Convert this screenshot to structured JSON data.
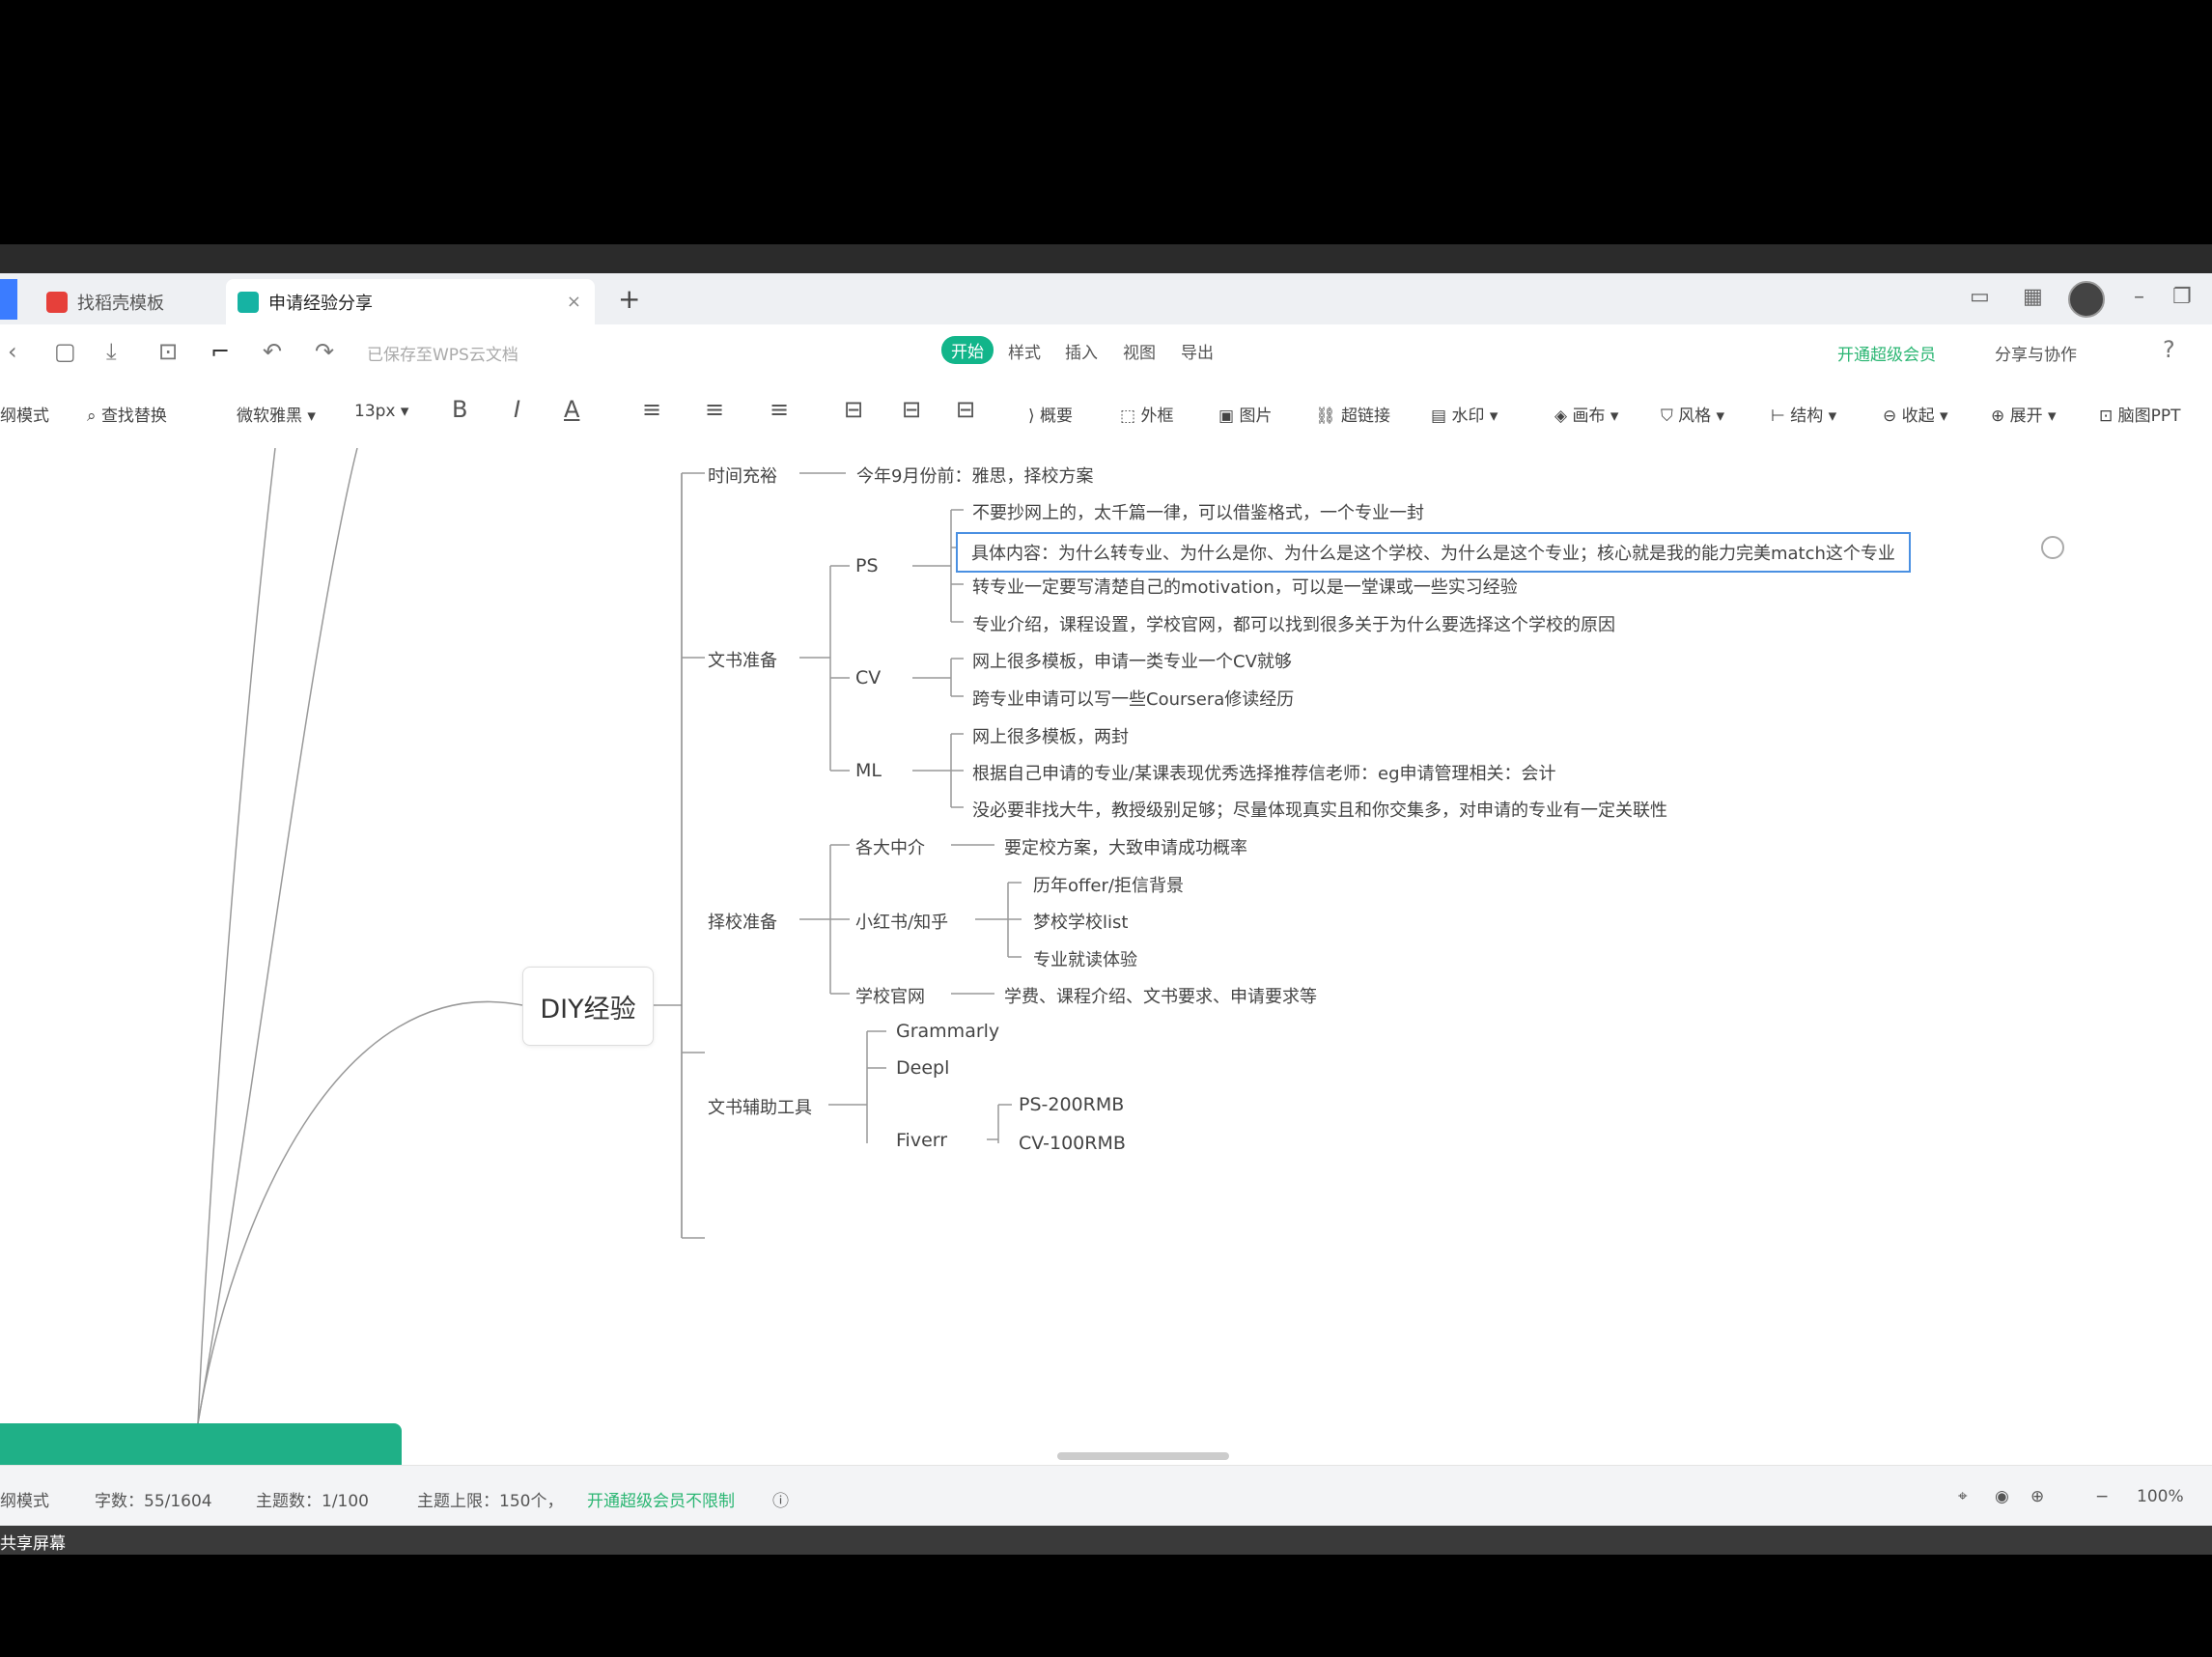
{
  "tabs": [
    {
      "label": "找稻壳模板"
    },
    {
      "label": "申请经验分享",
      "close": "×"
    }
  ],
  "new_tab_label": "+",
  "header": {
    "saved_status": "已保存至WPS云文档",
    "menu": [
      "开始",
      "样式",
      "插入",
      "视图",
      "导出"
    ],
    "upgrade": "开通超级会员",
    "share": "分享与协作",
    "help": "?"
  },
  "toolbar": {
    "mode": "纲模式",
    "find_replace": "查找替换",
    "font": "微软雅黑",
    "font_size": "13px",
    "bold": "B",
    "italic": "I",
    "font_color": "A",
    "summary": "概要",
    "frame": "外框",
    "image": "图片",
    "link": "超链接",
    "watermark": "水印",
    "layout": "画布",
    "style": "风格",
    "structure": "结构",
    "collapse": "收起",
    "expand": "展开",
    "ppt": "脑图PPT"
  },
  "mindmap": {
    "root": "DIY经验",
    "branches": {
      "timeline": {
        "label": "时间充裕",
        "child": "今年9月份前：雅思，择校方案"
      },
      "docs": {
        "label": "文书准备",
        "ps": {
          "label": "PS",
          "items": [
            "不要抄网上的，太千篇一律，可以借鉴格式，一个专业一封",
            "具体内容：为什么转专业、为什么是你、为什么是这个学校、为什么是这个专业；核心就是我的能力完美match这个专业",
            "转专业一定要写清楚自己的motivation，可以是一堂课或一些实习经验",
            "专业介绍，课程设置，学校官网，都可以找到很多关于为什么要选择这个学校的原因"
          ]
        },
        "cv": {
          "label": "CV",
          "items": [
            "网上很多模板，申请一类专业一个CV就够",
            "跨专业申请可以写一些Coursera修读经历"
          ]
        },
        "ml": {
          "label": "ML",
          "items": [
            "网上很多模板，两封",
            "根据自己申请的专业/某课表现优秀选择推荐信老师：eg申请管理相关：会计",
            "没必要非找大牛，教授级别足够；尽量体现真实且和你交集多，对申请的专业有一定关联性"
          ]
        }
      },
      "school": {
        "label": "择校准备",
        "agency": {
          "label": "各大中介",
          "child": "要定校方案，大致申请成功概率"
        },
        "xhs": {
          "label": "小红书/知乎",
          "items": [
            "历年offer/拒信背景",
            "梦校学校list",
            "专业就读体验"
          ]
        },
        "official": {
          "label": "学校官网",
          "child": "学费、课程介绍、文书要求、申请要求等"
        }
      },
      "tools": {
        "label": "文书辅助工具",
        "items": [
          "Grammarly",
          "Deepl",
          "Fiverr"
        ],
        "fiverr_items": [
          "PS-200RMB",
          "CV-100RMB"
        ]
      }
    }
  },
  "status": {
    "mode": "纲模式",
    "word_count": "字数：55/1604",
    "topic_count": "主题数：1/100",
    "topic_limit": "主题上限：150个，",
    "upgrade_unlimited": "开通超级会员不限制",
    "zoom_minus": "−",
    "zoom": "100%"
  },
  "share_screen": "共享屏幕"
}
